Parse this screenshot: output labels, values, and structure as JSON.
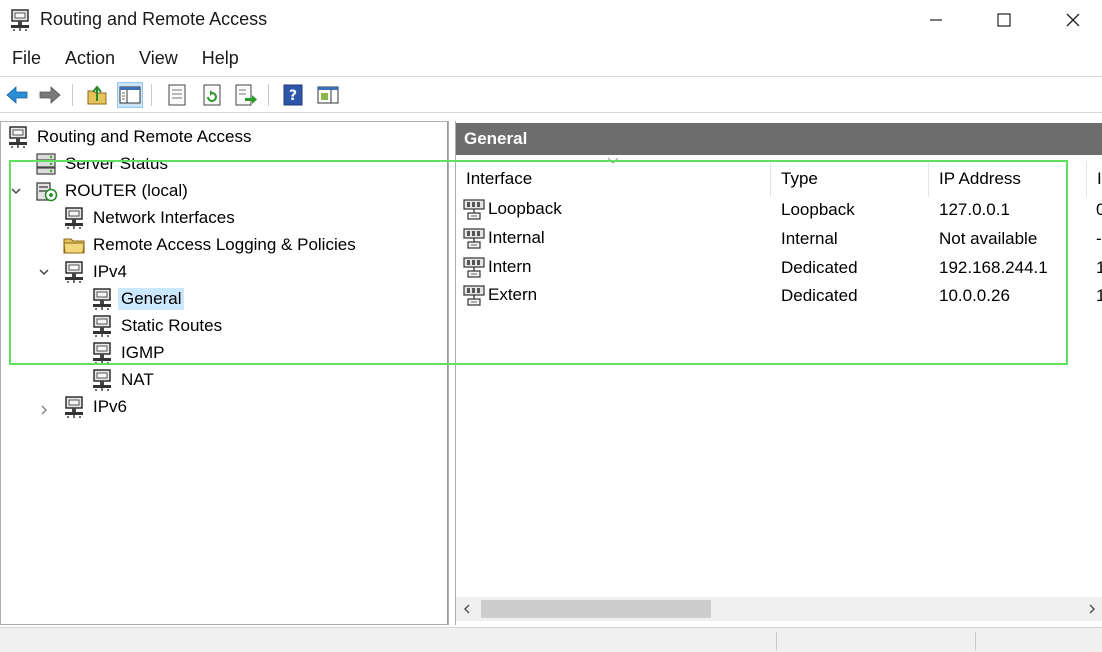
{
  "window": {
    "title": "Routing and Remote Access",
    "minimize_icon": "minimize-icon",
    "maximize_icon": "maximize-icon",
    "close_icon": "close-icon"
  },
  "menu": [
    "File",
    "Action",
    "View",
    "Help"
  ],
  "toolbar": {
    "icons": [
      "back-arrow-icon",
      "forward-arrow-icon",
      "up-folder-icon",
      "show-hide-tree-icon",
      "properties-icon",
      "refresh-icon",
      "export-list-icon",
      "help-icon",
      "show-hide-action-pane-icon"
    ]
  },
  "tree": {
    "root": "Routing and Remote Access",
    "server_status": "Server Status",
    "router": "ROUTER (local)",
    "network_interfaces": "Network Interfaces",
    "remote_access_logging": "Remote Access Logging & Policies",
    "ipv4": "IPv4",
    "general": "General",
    "static_routes": "Static Routes",
    "igmp": "IGMP",
    "nat": "NAT",
    "ipv6": "IPv6"
  },
  "details": {
    "header": "General",
    "columns": {
      "interface": "Interface",
      "type": "Type",
      "ip_address": "IP Address",
      "next": "I"
    },
    "rows": [
      {
        "interface": "Loopback",
        "type": "Loopback",
        "ip": "127.0.0.1",
        "next": "0"
      },
      {
        "interface": "Internal",
        "type": "Internal",
        "ip": "Not available",
        "next": "-"
      },
      {
        "interface": "Intern",
        "type": "Dedicated",
        "ip": "192.168.244.1",
        "next": "1"
      },
      {
        "interface": "Extern",
        "type": "Dedicated",
        "ip": "10.0.0.26",
        "next": "1"
      }
    ]
  },
  "colors": {
    "selection": "#cce8ff",
    "header_bg": "#6d6d6d",
    "highlight": "#5fe05f"
  }
}
